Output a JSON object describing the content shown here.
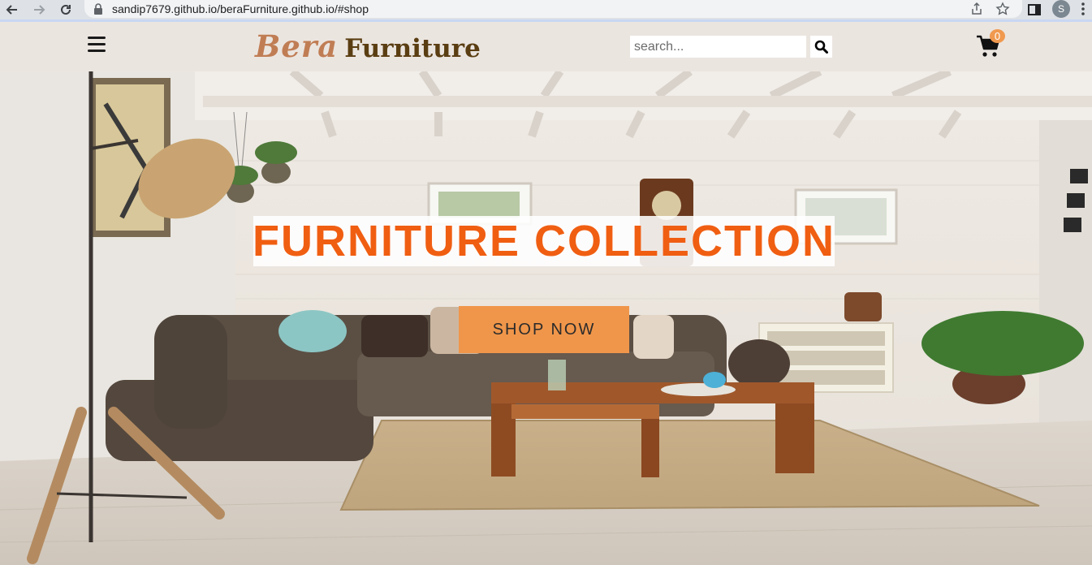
{
  "browser": {
    "url": "sandip7679.github.io/beraFurniture.github.io/#shop",
    "profile_initial": "S"
  },
  "header": {
    "logo_part1": "Bera",
    "logo_part2": "Furniture",
    "search_placeholder": "search...",
    "cart_count": "0"
  },
  "hero": {
    "title": "FURNITURE COLLECTION",
    "button_label": "SHOP NOW"
  },
  "colors": {
    "header_bg": "#ebe5e0",
    "logo_accent": "#c07d54",
    "logo_dark": "#5a3e12",
    "hero_title": "#f05e12",
    "button_bg": "#f0964a",
    "badge_bg": "#f0994f"
  },
  "icons": {
    "menu": "hamburger-icon",
    "search": "search-icon",
    "cart": "cart-icon"
  }
}
